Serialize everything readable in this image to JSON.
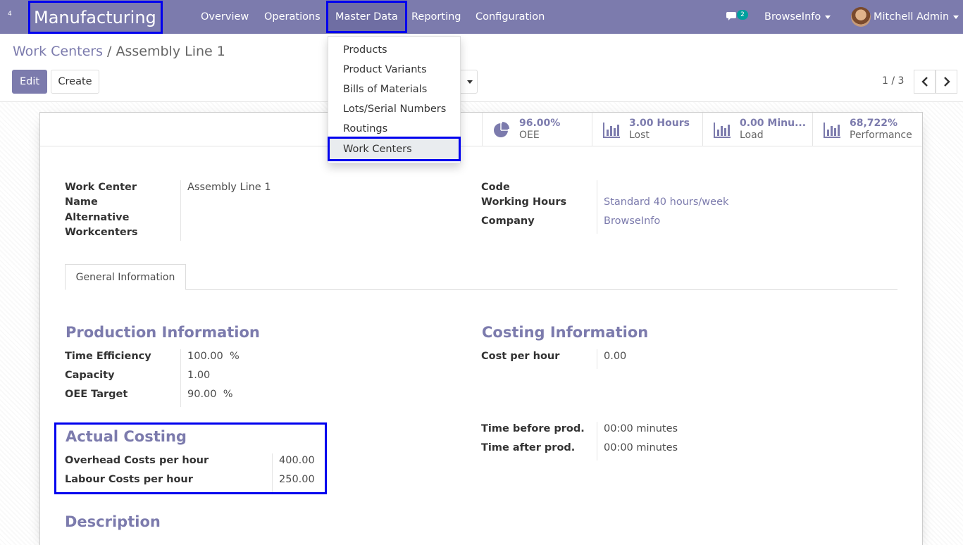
{
  "navbar": {
    "apps_badge": "4",
    "brand": "Manufacturing",
    "menu": {
      "overview": "Overview",
      "operations": "Operations",
      "master_data": "Master Data",
      "reporting": "Reporting",
      "configuration": "Configuration"
    },
    "messages_count": "2",
    "company": "BrowseInfo",
    "user": "Mitchell Admin",
    "bg_color": "#7c7bad"
  },
  "dropdown": {
    "items": [
      "Products",
      "Product Variants",
      "Bills of Materials",
      "Lots/Serial Numbers",
      "Routings",
      "Work Centers"
    ],
    "active_item": "Work Centers"
  },
  "breadcrumb": {
    "parent": "Work Centers",
    "separator": "/",
    "current": "Assembly Line 1"
  },
  "buttons": {
    "edit": "Edit",
    "create": "Create"
  },
  "pager": {
    "value": "1 / 3",
    "prev_icon": "chevron-left-icon",
    "next_icon": "chevron-right-icon"
  },
  "stats": [
    {
      "value": "96.00%",
      "label": "OEE",
      "icon": "pie-chart-icon"
    },
    {
      "value": "3.00 Hours",
      "label": "Lost",
      "icon": "bar-chart-icon"
    },
    {
      "value": "0.00 Minu...",
      "label": "Load",
      "icon": "bar-chart-icon"
    },
    {
      "value": "68,722%",
      "label": "Performance",
      "icon": "bar-chart-icon"
    }
  ],
  "form": {
    "work_center_name_label": "Work Center Name",
    "work_center_name_line1": "Work Center",
    "work_center_name_line2": "Name",
    "work_center_name": "Assembly Line 1",
    "alt_workcenters_line1": "Alternative",
    "alt_workcenters_line2": "Workcenters",
    "code_label": "Code",
    "working_hours_label": "Working Hours",
    "working_hours": "Standard 40 hours/week",
    "company_label": "Company",
    "company": "BrowseInfo"
  },
  "tab": {
    "general": "General Information"
  },
  "production": {
    "title": "Production Information",
    "time_efficiency_label": "Time Efficiency",
    "time_efficiency": "100.00",
    "time_efficiency_unit": "%",
    "capacity_label": "Capacity",
    "capacity": "1.00",
    "oee_target_label": "OEE Target",
    "oee_target": "90.00",
    "oee_target_unit": "%"
  },
  "costing": {
    "title": "Costing Information",
    "cost_per_hour_label": "Cost per hour",
    "cost_per_hour": "0.00",
    "time_before_label": "Time before prod.",
    "time_before": "00:00 minutes",
    "time_after_label": "Time after prod.",
    "time_after": "00:00 minutes"
  },
  "actual_costing": {
    "title": "Actual Costing",
    "overhead_label": "Overhead Costs per hour",
    "overhead": "400.00",
    "labour_label": "Labour Costs per hour",
    "labour": "250.00"
  },
  "description": {
    "title": "Description"
  },
  "highlight_color": "#0000ee"
}
